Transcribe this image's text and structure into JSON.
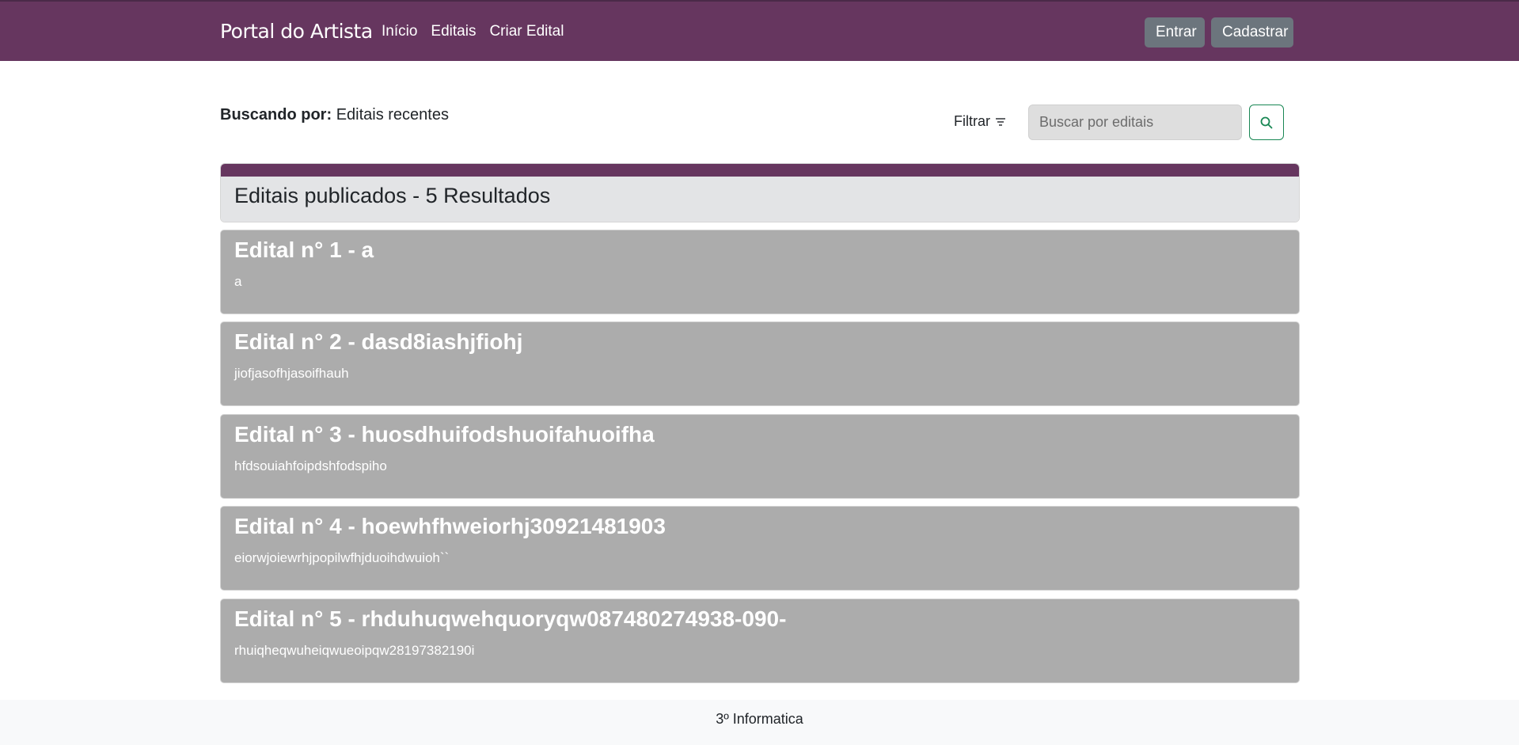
{
  "navbar": {
    "brand": "Portal do Artista",
    "links": [
      "Início",
      "Editais",
      "Criar Edital"
    ],
    "login_label": "Entrar",
    "signup_label": "Cadastrar",
    "color": "#66365f"
  },
  "search": {
    "label_prefix": "Buscando por:",
    "label_value": "Editais recentes",
    "filter_label": "Filtrar",
    "placeholder": "Buscar por editais"
  },
  "results": {
    "header": "Editais publicados - 5 Resultados",
    "items": [
      {
        "title": "Edital n° 1 - a",
        "description": "a"
      },
      {
        "title": "Edital n° 2 - dasd8iashjfiohj",
        "description": "jiofjasofhjasoifhauh"
      },
      {
        "title": "Edital n° 3 - huosdhuifodshuoifahuoifha",
        "description": "hfdsouiahfoipdshfodspiho"
      },
      {
        "title": "Edital n° 4 - hoewhfhweiorhj30921481903",
        "description": "eiorwjoiewrhjpopilwfhjduoihdwuioh``"
      },
      {
        "title": "Edital n° 5 - rhduhuqwehquoryqw087480274938-090-",
        "description": "rhuiqheqwuheiqwueoipqw28197382190i"
      }
    ]
  },
  "footer": {
    "text": "3º Informatica"
  }
}
